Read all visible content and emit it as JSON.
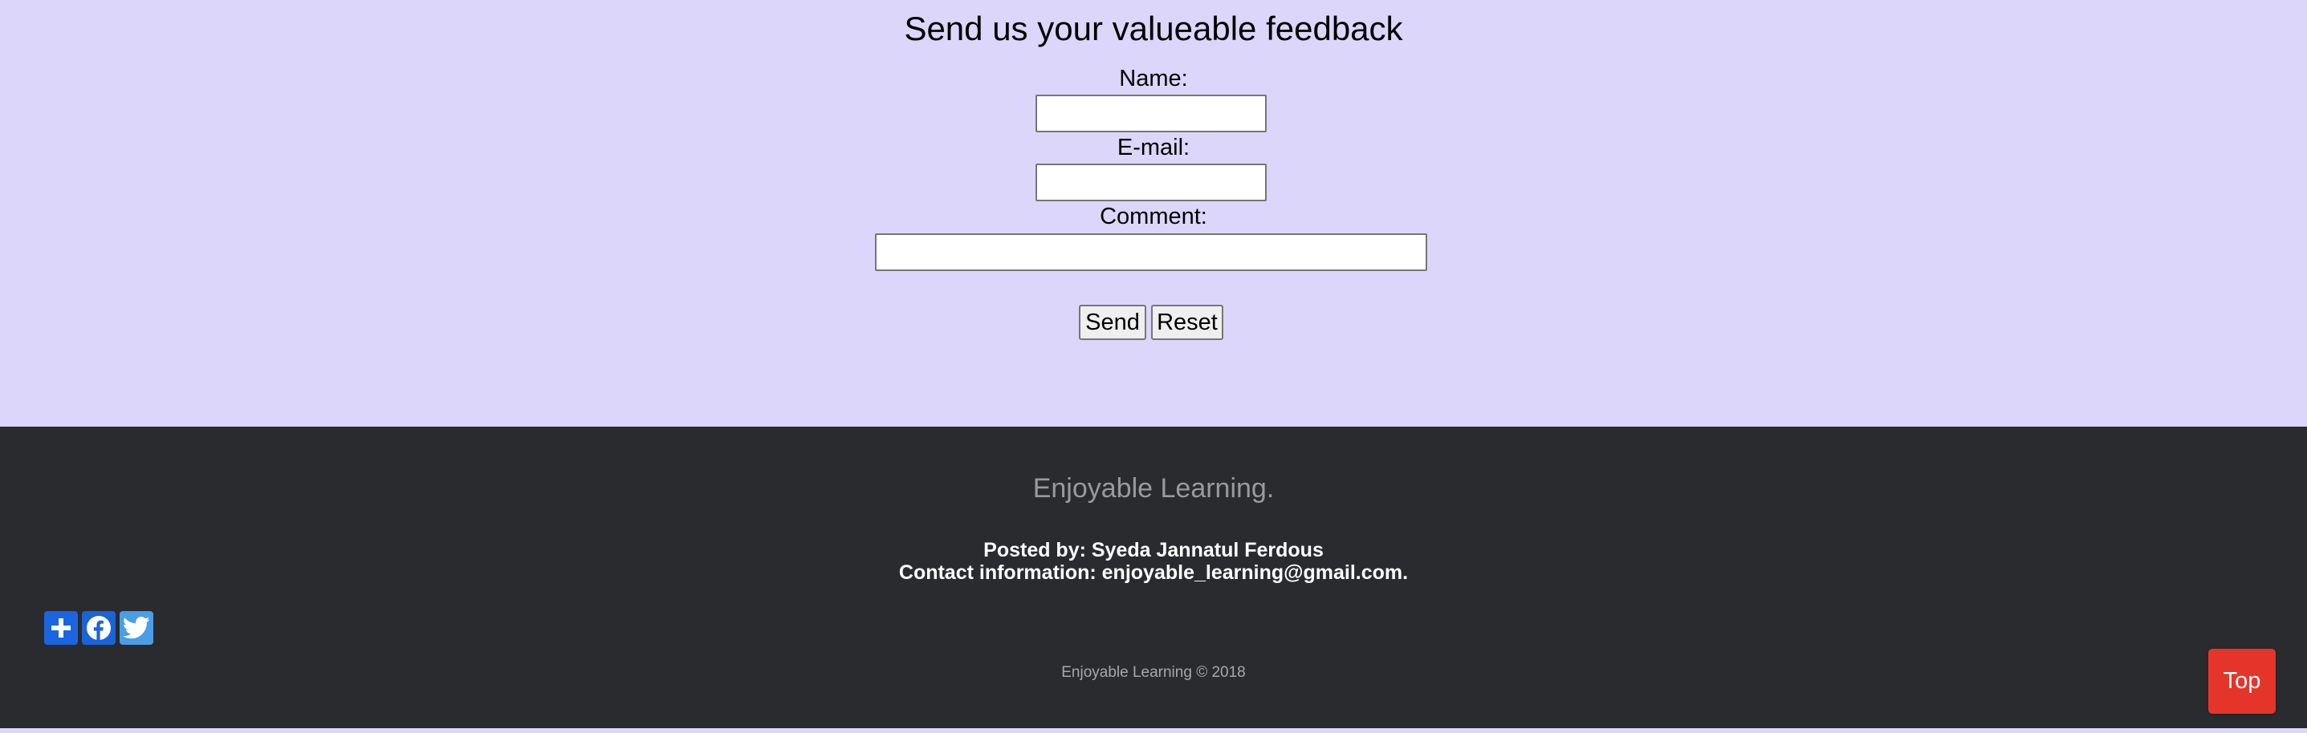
{
  "feedback": {
    "title": "Send us your valueable feedback",
    "name_label": "Name:",
    "name_value": "",
    "email_label": "E-mail:",
    "email_value": "",
    "comment_label": "Comment:",
    "comment_value": "",
    "send_label": "Send",
    "reset_label": "Reset"
  },
  "footer": {
    "brand": "Enjoyable Learning.",
    "posted_by": "Posted by: Syeda Jannatul Ferdous",
    "contact": "Contact information: enjoyable_learning@gmail.com.",
    "copyright": "Enjoyable Learning © 2018",
    "share_icons": [
      "add-share-icon",
      "facebook-icon",
      "twitter-icon"
    ],
    "top_label": "Top"
  },
  "colors": {
    "page_background": "#dcd6fa",
    "footer_background": "#2a2b2f",
    "share_add": "#1a65e0",
    "facebook": "#1b64d8",
    "twitter": "#4a9ee6",
    "top_button": "#e5352a"
  }
}
